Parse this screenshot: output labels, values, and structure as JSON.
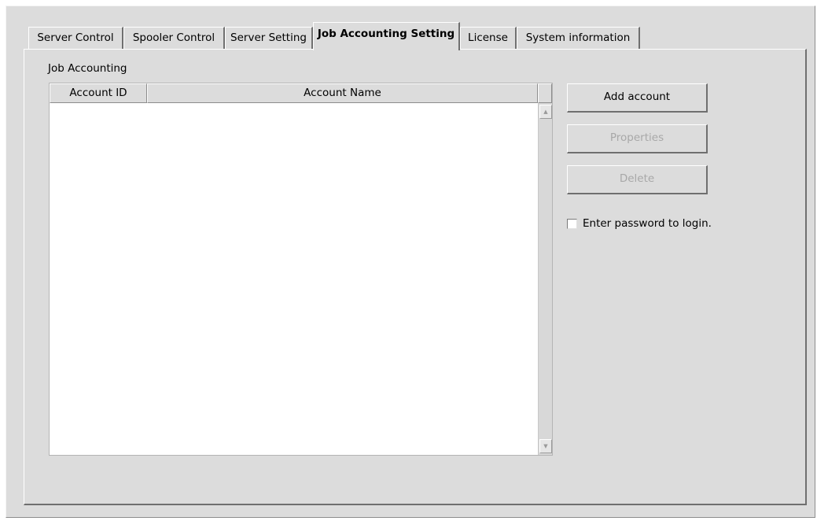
{
  "tabs": [
    {
      "label": "Server Control",
      "active": false
    },
    {
      "label": "Spooler Control",
      "active": false
    },
    {
      "label": "Server Setting",
      "active": false
    },
    {
      "label": "Job Accounting Setting",
      "active": true
    },
    {
      "label": "License",
      "active": false
    },
    {
      "label": "System information",
      "active": false
    }
  ],
  "panel": {
    "group_label": "Job Accounting",
    "table": {
      "columns": [
        "Account ID",
        "Account Name"
      ],
      "rows": []
    },
    "buttons": {
      "add": "Add account",
      "properties": "Properties",
      "delete": "Delete"
    },
    "password_checkbox": {
      "label": "Enter password to login.",
      "checked": false
    }
  }
}
